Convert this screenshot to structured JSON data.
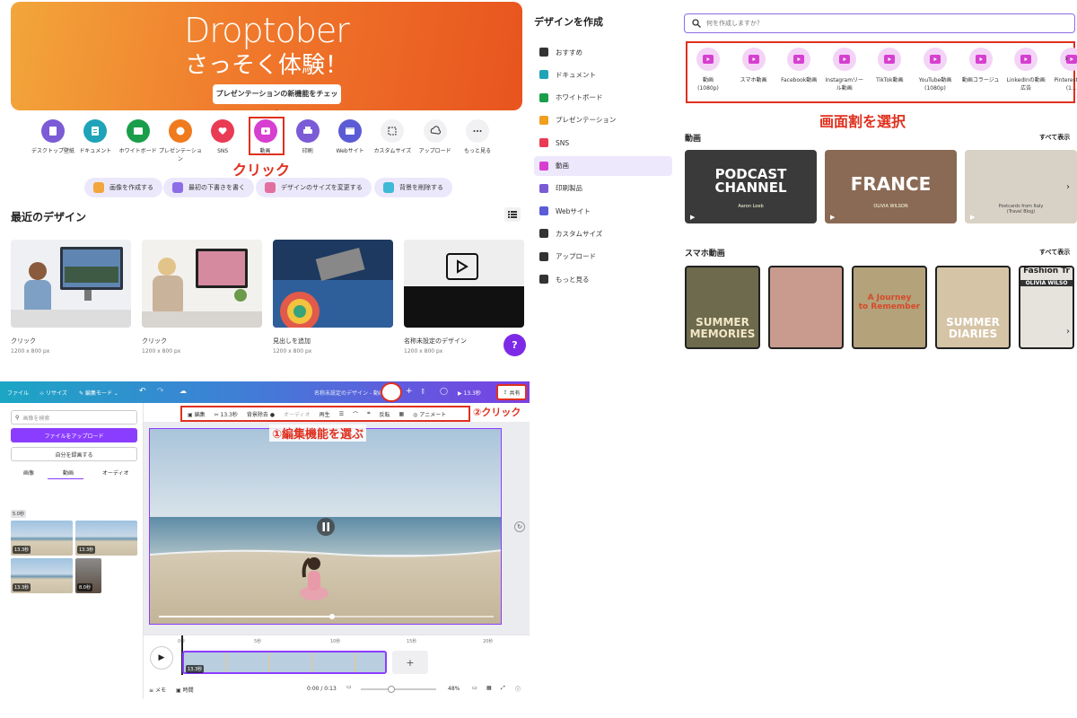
{
  "panel1": {
    "hero": {
      "title": "Droptober",
      "subtitle": "さっそく体験！",
      "button": "プレゼンテーションの新機能をチェック"
    },
    "categories": [
      {
        "label": "デスクトップ壁紙",
        "color": "#7b5bd6",
        "icon": "wallpaper-icon"
      },
      {
        "label": "ドキュメント",
        "color": "#1fa3b8",
        "icon": "doc-icon"
      },
      {
        "label": "ホワイトボード",
        "color": "#1b9e4b",
        "icon": "whiteboard-icon"
      },
      {
        "label": "プレゼンテーション",
        "color": "#f07a1e",
        "icon": "presentation-icon"
      },
      {
        "label": "SNS",
        "color": "#ea3b55",
        "icon": "heart-icon"
      },
      {
        "label": "動画",
        "color": "#d63fd0",
        "icon": "video-icon"
      },
      {
        "label": "印刷",
        "color": "#7b5bd6",
        "icon": "print-icon"
      },
      {
        "label": "Webサイト",
        "color": "#5b5bd6",
        "icon": "web-icon"
      },
      {
        "label": "カスタムサイズ",
        "color": "#f1f1f3",
        "icon": "custom-size-icon"
      },
      {
        "label": "アップロード",
        "color": "#f1f1f3",
        "icon": "upload-icon"
      },
      {
        "label": "もっと見る",
        "color": "#f1f1f3",
        "icon": "more-icon"
      }
    ],
    "annotation": "クリック",
    "chips": [
      {
        "label": "画像を作成する",
        "color": "#f2a63b"
      },
      {
        "label": "最初の下書きを書く",
        "color": "#8d6ee6"
      },
      {
        "label": "デザインのサイズを変更する",
        "color": "#e36fa0"
      },
      {
        "label": "背景を削除する",
        "color": "#3fb9d6"
      }
    ],
    "recent_title": "最近のデザイン",
    "recent": [
      {
        "title": "クリック",
        "size": "1200 x 800 px"
      },
      {
        "title": "クリック",
        "size": "1200 x 800 px"
      },
      {
        "title": "見出しを追加",
        "size": "1200 x 800 px"
      },
      {
        "title": "名称未設定のデザイン",
        "size": "1200 x 800 px"
      }
    ],
    "help": "?"
  },
  "panel2": {
    "title": "デザインを作成",
    "items": [
      {
        "label": "おすすめ",
        "color": "#333"
      },
      {
        "label": "ドキュメント",
        "color": "#1fa3b8"
      },
      {
        "label": "ホワイトボード",
        "color": "#1b9e4b"
      },
      {
        "label": "プレゼンテーション",
        "color": "#f0a01e"
      },
      {
        "label": "SNS",
        "color": "#ea3b55"
      },
      {
        "label": "動画",
        "color": "#d63fd0"
      },
      {
        "label": "印刷製品",
        "color": "#7b5bd6"
      },
      {
        "label": "Webサイト",
        "color": "#5b5bd6"
      },
      {
        "label": "カスタムサイズ",
        "color": "#333"
      },
      {
        "label": "アップロード",
        "color": "#333"
      },
      {
        "label": "もっと見る",
        "color": "#333"
      }
    ]
  },
  "panel3": {
    "search_placeholder": "何を作成しますか？",
    "types": [
      "動画\n(1080p)",
      "スマホ動画",
      "Facebook動画",
      "Instagramリール動画",
      "TikTok動画",
      "YouTube動画\n(1080p)",
      "動画コラージュ",
      "LinkedInの動画広告",
      "Pinterestピン (1..."
    ],
    "annotation": "画面割を選択",
    "section1": "動画",
    "section2": "スマホ動画",
    "see_all": "すべて表示",
    "video_thumbs": [
      {
        "title": "PODCAST\nCHANNEL",
        "small": "Aaron Loeb"
      },
      {
        "title": "FRANCE",
        "small": "OLIVIA WILSON"
      },
      {
        "title": "",
        "small": "Postcards from Italy\n(Travel Blog)"
      }
    ],
    "phone_thumbs": [
      {
        "title": "SUMMER\nMEMORIES"
      },
      {
        "title": ""
      },
      {
        "title": "A Journey\nto Remember"
      },
      {
        "title": "SUMMER\nDIARIES"
      },
      {
        "title": "Fashion Tr",
        "small": "OLIVIA WILSO"
      }
    ]
  },
  "panel4": {
    "topbar": {
      "file": "ファイル",
      "resize": "リサイズ",
      "edit_mode": "編集モード",
      "doc_title": "名称未設定のデザイン - 動画",
      "duration": "13.3秒",
      "share": "共有"
    },
    "annotation_click": "②クリック",
    "annotation_edit": "①編集機能を選ぶ",
    "toolbar": [
      "編集",
      "13.3秒",
      "背景除去",
      "オーディオ",
      "再生",
      "反転",
      "アニメート"
    ],
    "left": {
      "search_placeholder": "画像を検索",
      "upload": "ファイルをアップロード",
      "record": "自分を録画する",
      "tabs": [
        "画像",
        "動画",
        "オーディオ"
      ],
      "count": "5.0秒",
      "clip_durations": [
        "13.3秒",
        "13.3秒",
        "13.3秒",
        "8.0秒"
      ]
    },
    "timeline": {
      "ticks": [
        "0秒",
        "5秒",
        "10秒",
        "15秒",
        "20秒"
      ],
      "clip_len": "13.3秒",
      "add": "+"
    },
    "bottom": {
      "notes": "メモ",
      "duration_label": "時間",
      "time": "0:00 / 0:13",
      "zoom": "48%"
    }
  }
}
